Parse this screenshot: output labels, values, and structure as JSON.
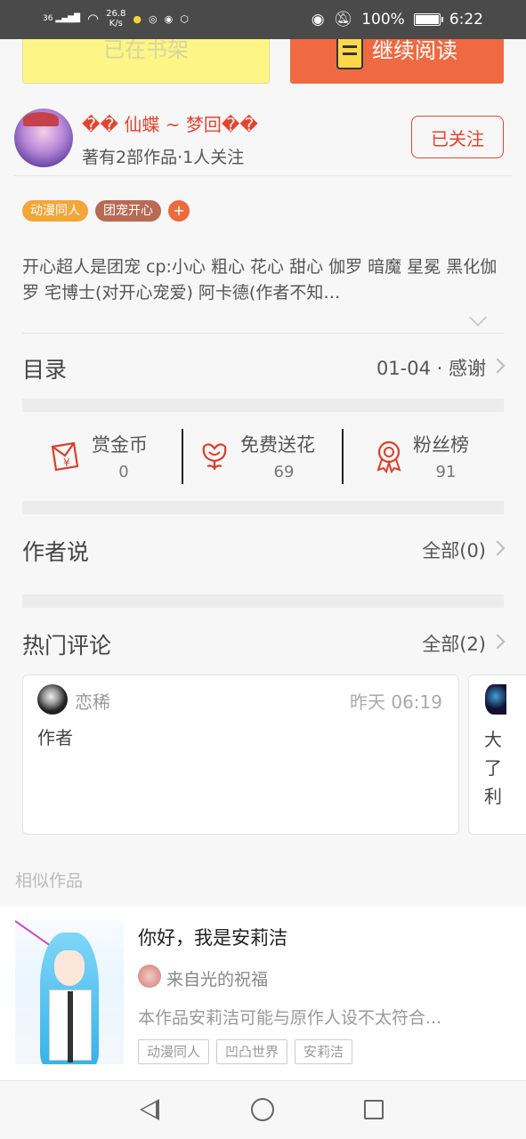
{
  "status_bar": {
    "signal": "36",
    "net_speed": "26.8",
    "net_unit": "K/s",
    "battery": "100%",
    "time": "6:22"
  },
  "actions": {
    "shelf_label": "已在书架",
    "read_label": "继续阅读"
  },
  "author": {
    "name": "�� 仙蝶 ~ 梦回��",
    "meta": "著有2部作品·1人关注",
    "follow_label": "已关注"
  },
  "tags": [
    {
      "label": "动漫同人",
      "color": "#f3a63a"
    },
    {
      "label": "团宠开心",
      "color": "#b86a54"
    }
  ],
  "tag_add": "+",
  "description": "开心超人是团宠 cp:小心 粗心 花心 甜心 伽罗 暗魔 星冕 黑化伽罗 宅博士(对开心宠爱) 阿卡德(作者不知…",
  "catalog": {
    "title": "目录",
    "latest": "01-04 · 感谢"
  },
  "stats": [
    {
      "label": "赏金币",
      "value": "0",
      "icon": "red-envelope-icon"
    },
    {
      "label": "免费送花",
      "value": "69",
      "icon": "flower-icon"
    },
    {
      "label": "粉丝榜",
      "value": "91",
      "icon": "medal-icon"
    }
  ],
  "author_says": {
    "title": "作者说",
    "all_label": "全部(0)"
  },
  "hot_comments": {
    "title": "热门评论",
    "all_label": "全部(2)",
    "items": [
      {
        "user": "恋稀",
        "time": "昨天 06:19",
        "text": "作者"
      },
      {
        "lines": [
          "大",
          "了",
          "利"
        ]
      }
    ]
  },
  "similar": {
    "title": "相似作品",
    "items": [
      {
        "title": "你好，我是安莉洁",
        "author": "来自光的祝福",
        "desc": "本作品安莉洁可能与原作人设不太符合...",
        "tags": [
          "动漫同人",
          "凹凸世界",
          "安莉洁"
        ]
      }
    ]
  },
  "colors": {
    "accent": "#ef6a43",
    "author_red": "#e2452f",
    "shelf_yellow": "#fdf586"
  }
}
